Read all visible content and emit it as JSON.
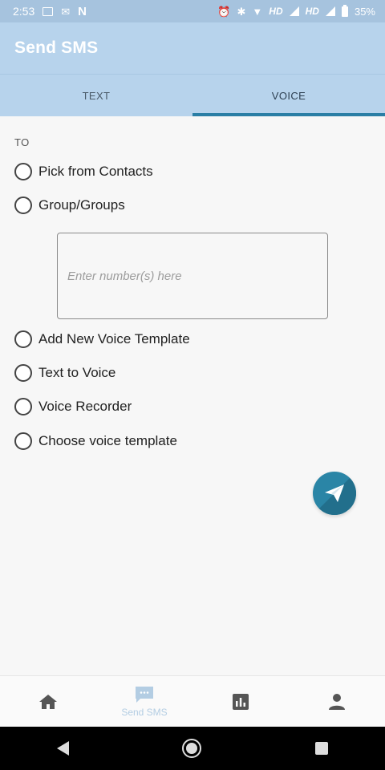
{
  "status_bar": {
    "time": "2:53",
    "signal1": "HD",
    "signal2": "HD",
    "battery": "35%"
  },
  "app_bar": {
    "title": "Send SMS"
  },
  "tabs": [
    {
      "label": "TEXT",
      "active": false
    },
    {
      "label": "VOICE",
      "active": true
    }
  ],
  "form": {
    "to_label": "TO",
    "options": [
      "Pick from Contacts",
      "Group/Groups",
      "Add New Voice Template",
      "Text to Voice",
      "Voice Recorder",
      "Choose voice template"
    ],
    "numbers_placeholder": "Enter number(s) here",
    "numbers_value": ""
  },
  "fab": {
    "icon": "send-icon",
    "color": "#2a85a6"
  },
  "bottom_nav": [
    {
      "icon": "home-icon",
      "label": ""
    },
    {
      "icon": "message-icon",
      "label": "Send SMS",
      "active": true
    },
    {
      "icon": "chart-icon",
      "label": ""
    },
    {
      "icon": "person-icon",
      "label": ""
    }
  ],
  "colors": {
    "appbar": "#b7d3ec",
    "accent": "#2a7ea5",
    "active_nav": "#b3cde3"
  }
}
